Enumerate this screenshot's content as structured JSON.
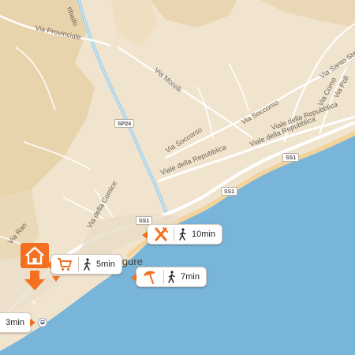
{
  "map": {
    "colors": {
      "land": "#f1e4cf",
      "hills": "#e6cfa3",
      "sea": "#79b4d9",
      "beach": "#f4d39b",
      "road": "#ffffff",
      "motorway": "#9fd0ea",
      "accent": "#f37021"
    },
    "street_labels": [
      "Via Provinciale",
      "Via Morelli",
      "Via Santo Stefano",
      "Via Como",
      "Via Poll",
      "Via Soccorso",
      "Via Soccorso",
      "Viale della Repubblica",
      "Viale della Repubblica",
      "Viale della Repubblica",
      "Via della Comice",
      "Via Ran",
      "nbado"
    ],
    "road_shields": [
      "SP24",
      "SS1",
      "SS1",
      "SS1"
    ],
    "place_label": "igure",
    "station_icon": "train-station-icon"
  },
  "pois": [
    {
      "icon": "restaurant-icon",
      "mode_icon": "walk-icon",
      "time": "10min"
    },
    {
      "icon": "shopping-cart-icon",
      "mode_icon": "walk-icon",
      "time": "5min"
    },
    {
      "icon": "beach-umbrella-icon",
      "mode_icon": "walk-icon",
      "time": "7min"
    },
    {
      "icon": "train-icon",
      "mode_icon": "walk-icon",
      "time": "3min"
    }
  ],
  "home_marker": {
    "icon": "home-icon"
  }
}
